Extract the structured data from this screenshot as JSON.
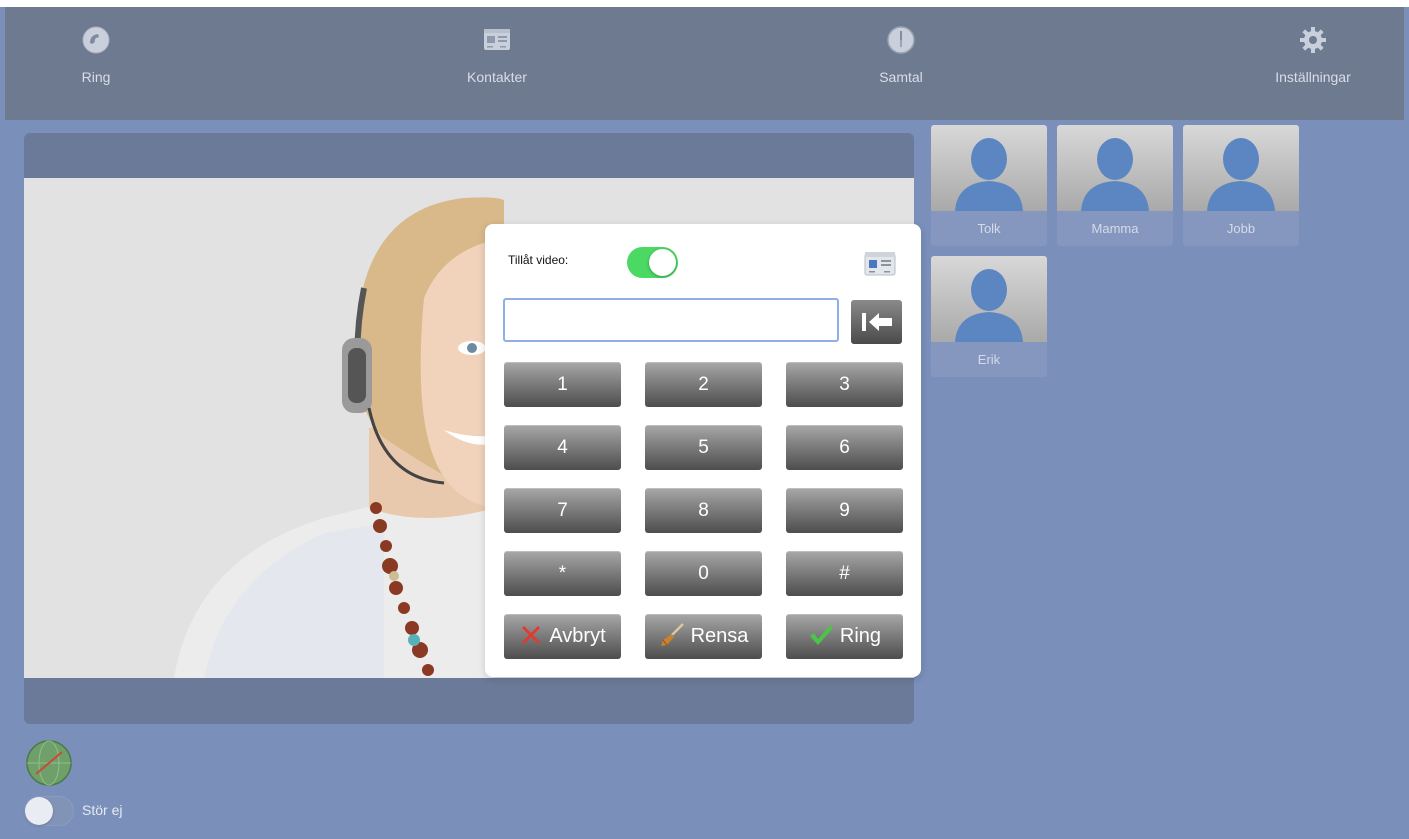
{
  "nav": {
    "items": [
      {
        "label": "Ring",
        "icon": "phone-icon"
      },
      {
        "label": "Kontakter",
        "icon": "contacts-card-icon"
      },
      {
        "label": "Samtal",
        "icon": "clock-icon"
      },
      {
        "label": "Inställningar",
        "icon": "gear-icon"
      }
    ]
  },
  "contacts": [
    {
      "name": "Tolk"
    },
    {
      "name": "Mamma"
    },
    {
      "name": "Jobb"
    },
    {
      "name": "Erik"
    }
  ],
  "dialer": {
    "video_label": "Tillåt video:",
    "video_enabled": true,
    "number_value": "",
    "keys": [
      "1",
      "2",
      "3",
      "4",
      "5",
      "6",
      "7",
      "8",
      "9",
      "*",
      "0",
      "#"
    ],
    "actions": {
      "cancel": "Avbryt",
      "clear": "Rensa",
      "call": "Ring"
    }
  },
  "status": {
    "dnd_label": "Stör ej",
    "dnd_enabled": false
  },
  "colors": {
    "background": "#7a8fba",
    "topbar": "#6e7a90",
    "toggle_on": "#4bd863"
  }
}
